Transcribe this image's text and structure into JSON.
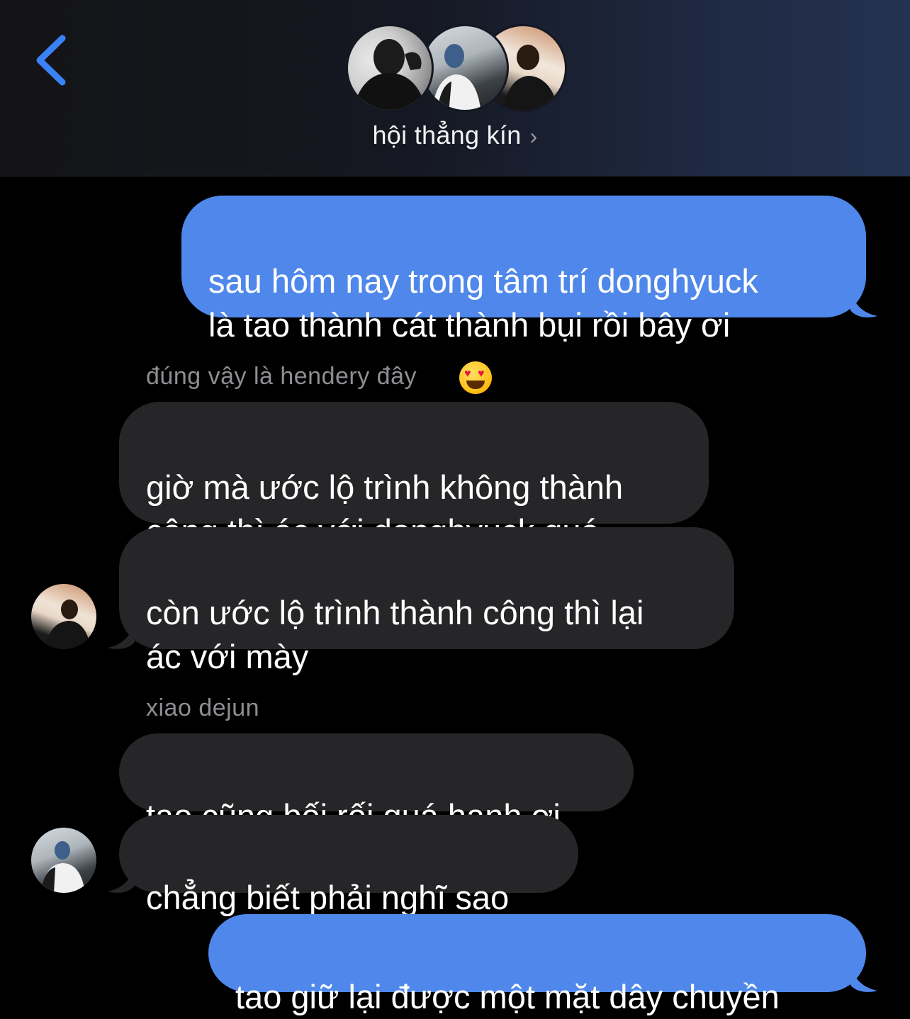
{
  "header": {
    "group_name": "hội thẳng kín",
    "chevron": "›"
  },
  "messages": [
    {
      "direction": "outgoing",
      "text": "sau hôm nay trong tâm trí donghyuck\nlà tao thành cát thành bụi rồi bây ơi"
    },
    {
      "direction": "incoming",
      "sender": "đúng vậy là hendery đây",
      "sender_emoji": "heart-eyes-emoji",
      "text": "giờ mà ước lộ trình không thành\ncông thì ác với donghyuck quá"
    },
    {
      "direction": "incoming",
      "text": "còn ước lộ trình thành công thì lại\nác với mày"
    },
    {
      "direction": "incoming",
      "sender": "xiao dejun",
      "text": "tao cũng bối rối quá hanh ơi"
    },
    {
      "direction": "incoming",
      "text": "chẳng biết phải nghĩ sao"
    },
    {
      "direction": "outgoing",
      "text": "tao giữ lại được một mặt dây chuyền"
    }
  ],
  "colors": {
    "outgoing_bubble": "#4f88ea",
    "incoming_bubble": "#262628",
    "accent": "#3b82f6"
  }
}
